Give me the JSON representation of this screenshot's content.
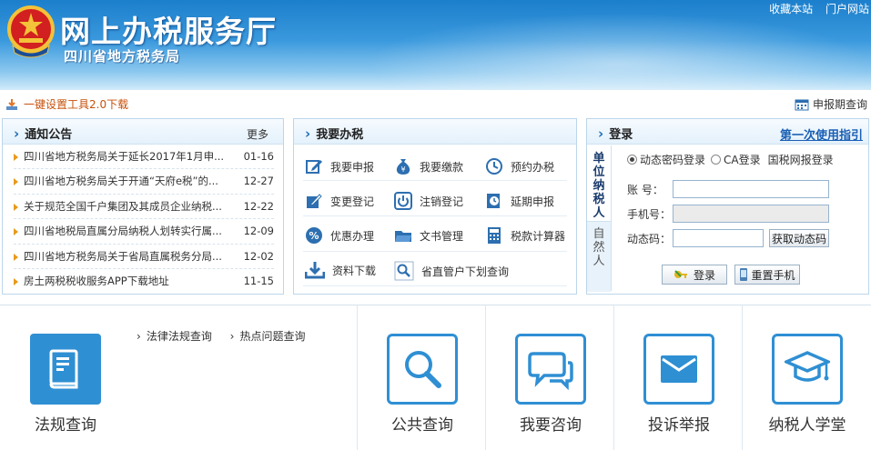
{
  "header": {
    "title": "网上办税服务厅",
    "subtitle": "四川省地方税务局",
    "links": [
      "收藏本站",
      "门户网站"
    ]
  },
  "toolbar": {
    "download_label": "一键设置工具2.0下载",
    "report_label": "申报期查询"
  },
  "notice": {
    "title": "通知公告",
    "more": "更多",
    "items": [
      {
        "text": "四川省地方税务局关于延长2017年1月申...",
        "date": "01-16"
      },
      {
        "text": "四川省地方税务局关于开通“天府e税”的...",
        "date": "12-27"
      },
      {
        "text": "关于规范全国千户集团及其成员企业纳税...",
        "date": "12-22"
      },
      {
        "text": "四川省地税局直属分局纳税人划转实行属...",
        "date": "12-09"
      },
      {
        "text": "四川省地方税务局关于省局直属税务分局...",
        "date": "12-02"
      },
      {
        "text": "房土两税税收服务APP下载地址",
        "date": "11-15"
      }
    ]
  },
  "tax": {
    "title": "我要办税",
    "items": [
      {
        "label": "我要申报",
        "icon": "edit-icon"
      },
      {
        "label": "我要缴款",
        "icon": "money-bag-icon"
      },
      {
        "label": "预约办税",
        "icon": "clock-icon"
      },
      {
        "label": "变更登记",
        "icon": "edit-doc-icon"
      },
      {
        "label": "注销登记",
        "icon": "power-icon"
      },
      {
        "label": "延期申报",
        "icon": "clock-doc-icon"
      },
      {
        "label": "优惠办理",
        "icon": "percent-icon"
      },
      {
        "label": "文书管理",
        "icon": "folder-icon"
      },
      {
        "label": "税款计算器",
        "icon": "calculator-icon"
      },
      {
        "label": "资料下载",
        "icon": "download-icon"
      },
      {
        "label": "省直管户下划查询",
        "icon": "search-doc-icon"
      }
    ]
  },
  "login": {
    "title": "登录",
    "guide": "第一次使用指引",
    "tab_unit": "单位纳税人",
    "tab_natural": "自然人",
    "radio_dynamic": "动态密码登录",
    "radio_ca": "CA登录",
    "radio_national": "国税网报登录",
    "account_label": "账 号：",
    "phone_label": "手机号：",
    "code_label": "动态码：",
    "get_code": "获取动态码",
    "login_btn": "登录",
    "reset_btn": "重置手机"
  },
  "bottom": {
    "law_query": "法规查询",
    "law_links": [
      "法律法规查询",
      "热点问题查询"
    ],
    "public_query": "公共查询",
    "consult": "我要咨询",
    "complaint": "投诉举报",
    "school": "纳税人学堂"
  },
  "colors": {
    "accent": "#2f8fd3",
    "link_orange": "#c8500a",
    "guide_blue": "#1a5fb4"
  }
}
